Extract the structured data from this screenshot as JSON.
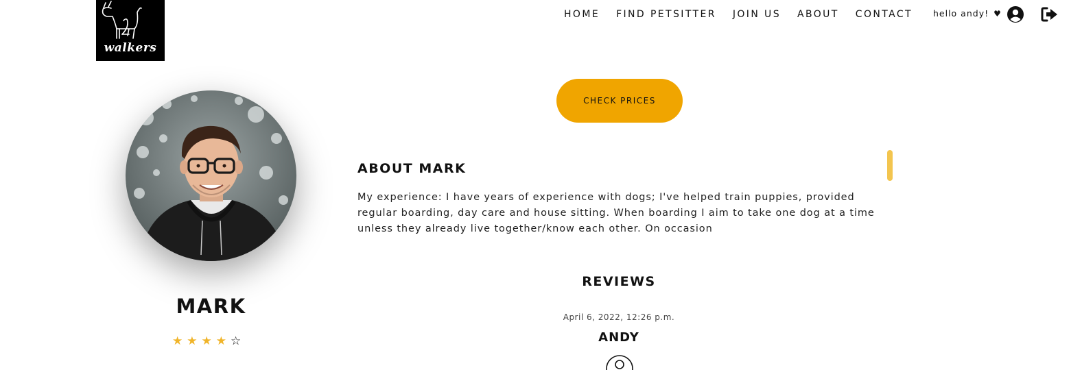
{
  "brand": {
    "logo_text": "walkers"
  },
  "nav": {
    "links": [
      "HOME",
      "FIND PETSITTER",
      "JOIN US",
      "ABOUT",
      "CONTACT"
    ],
    "greeting": "hello andy!",
    "heart": "♥",
    "user_icon": "user-circle-icon",
    "logout_icon": "logout-icon"
  },
  "profile": {
    "name": "MARK",
    "rating": 4,
    "rating_max": 5,
    "stars": [
      "★",
      "★",
      "★",
      "★",
      "☆"
    ]
  },
  "actions": {
    "check_prices": "CHECK PRICES"
  },
  "about": {
    "heading": "ABOUT MARK",
    "text": "My experience: I have years of experience with dogs; I've helped train puppies, provided regular boarding, day care and house sitting. When boarding I aim to take one dog at a time unless they already live together/know each other. On occasion"
  },
  "reviews": {
    "heading": "REVIEWS",
    "items": [
      {
        "date": "April 6, 2022, 12:26 p.m.",
        "author": "ANDY"
      }
    ]
  },
  "colors": {
    "accent": "#f0a500",
    "star": "#f0b429",
    "scrollbar": "#f3c54f",
    "logo_bg": "#000000"
  }
}
